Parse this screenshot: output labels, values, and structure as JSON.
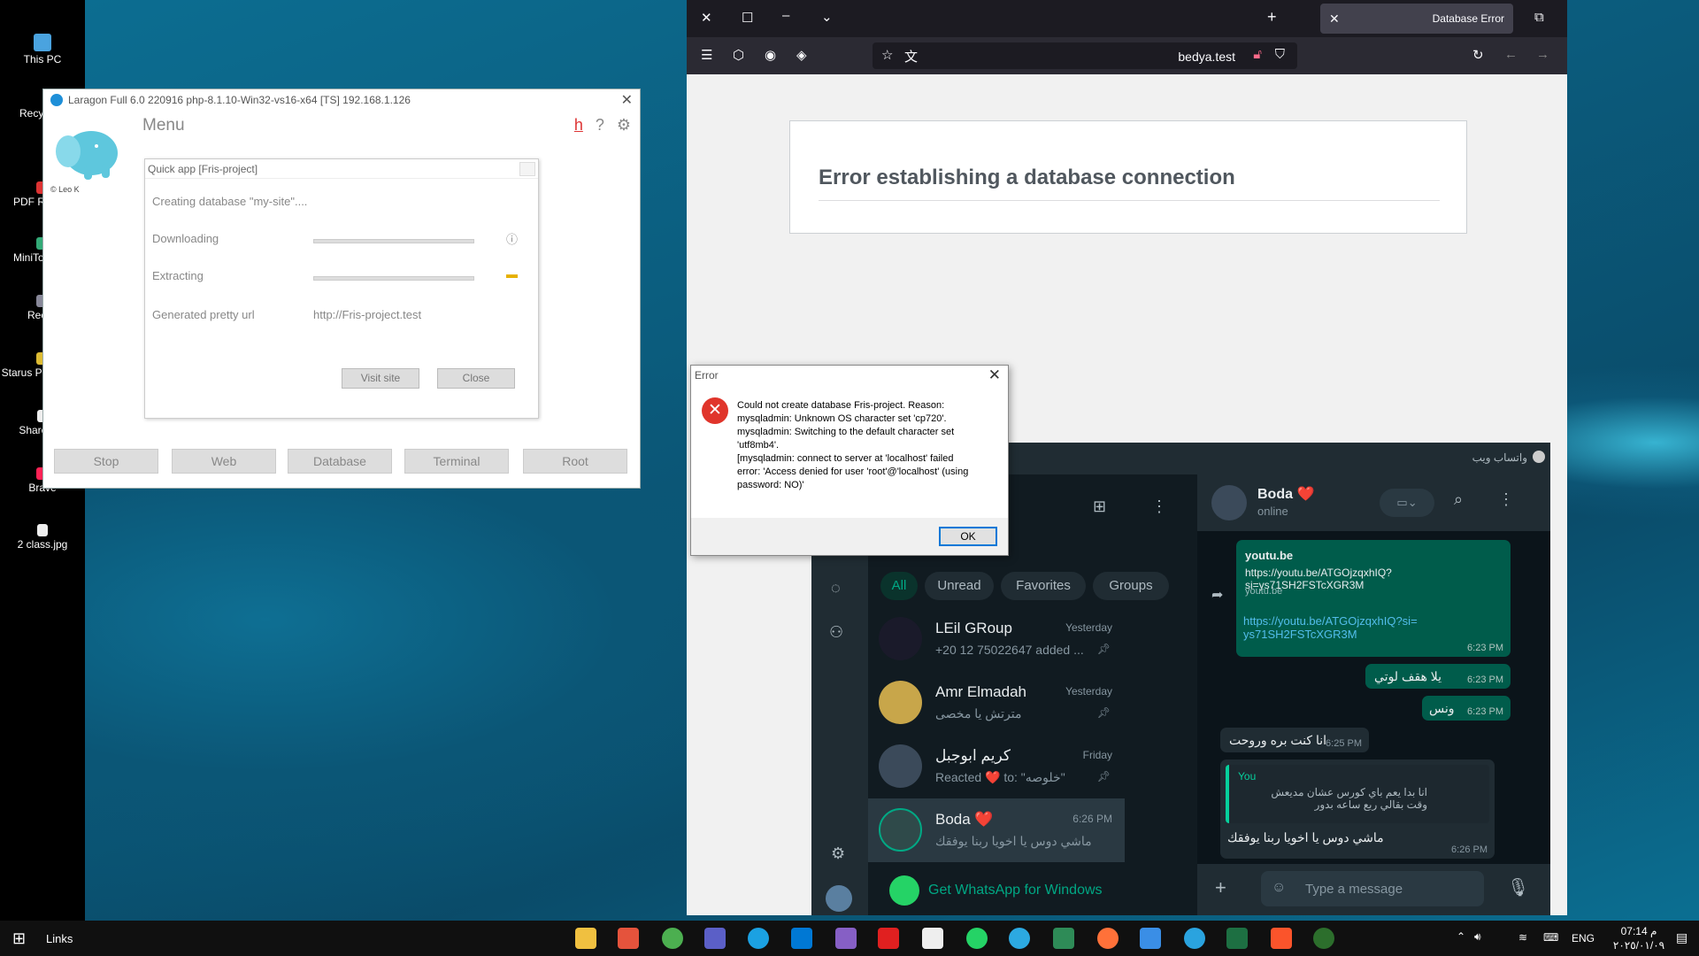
{
  "desktop": {
    "icons": [
      "This PC",
      "Recyc",
      "PDF Rea 10",
      "MiniTo Partit",
      "Recuv",
      "Starus Pl Recove",
      "SharedSe",
      "Brave",
      "2 class.jpg"
    ]
  },
  "laragon": {
    "title": "Laragon Full 6.0 220916 php-8.1.10-Win32-vs16-x64 [TS]  192.168.1.126",
    "copyright": "© Leo K",
    "menu": "Menu",
    "help_h": "h",
    "help_q": "?",
    "buttons": [
      "Stop",
      "Web",
      "Database",
      "Terminal",
      "Root"
    ],
    "quick_app": {
      "title": "Quick app [Fris-project]",
      "status": "Creating database \"my-site\"....",
      "downloading": "Downloading",
      "extracting": "Extracting",
      "pretty_url_label": "Generated pretty url",
      "pretty_url": "http://Fris-project.test",
      "visit_site": "Visit site",
      "close": "Close"
    }
  },
  "browser": {
    "tab_title": "Database Error",
    "url": "bedya.test",
    "heading": "Error establishing a database connection"
  },
  "error_dialog": {
    "title": "Error",
    "message": "Could not create database Fris-project. Reason:\nmysqladmin: Unknown OS character set 'cp720'.\nmysqladmin: Switching to the default character set\n'utf8mb4'.\n[mysqladmin: connect to server at 'localhost' failed\nerror: 'Access denied for user 'root'@'localhost' (using\npassword: NO)'",
    "ok": "OK"
  },
  "whatsapp": {
    "title": "واتساب ويب",
    "filters": [
      "All",
      "Unread",
      "Favorites",
      "Groups"
    ],
    "chats": [
      {
        "name": "LEil GRoup",
        "preview": "+20 12 75022647 added ...",
        "time": "Yesterday"
      },
      {
        "name": "Amr Elmadah",
        "preview": "مترتش يا مخصى",
        "time": "Yesterday"
      },
      {
        "name": "كريم ابوجبل",
        "preview": "Reacted ❤️ to: \"خلوصه\"",
        "time": "Friday"
      },
      {
        "name": "Boda ❤️",
        "preview": "ماشي دوس يا اخويا ربنا يوفقك",
        "time": "6:26 PM"
      }
    ],
    "get_app": "Get WhatsApp for Windows",
    "contact": {
      "name": "Boda ❤️",
      "status": "online"
    },
    "messages": [
      {
        "site": "youtu.be",
        "link": "https://youtu.be/ATGOjzqxhIQ?si=ys71SH2FSTcXGR3M",
        "domain": "youtu.be",
        "time": ""
      },
      {
        "text": "https://youtu.be/ATGOjzqxhIQ?si=ys71SH2FSTcXGR3M",
        "time": "6:23 PM"
      },
      {
        "text": "يلا هقف لوتي",
        "time": "6:23 PM"
      },
      {
        "text": "ونس",
        "time": "6:23 PM"
      },
      {
        "text": "انا كنت بره وروحت",
        "time": "6:25 PM"
      },
      {
        "quote_author": "You",
        "quote_text": "انا بدا يعم باي كورس عشان مديعش وقت بقالي ربع ساعه بدور",
        "text": "ماشي دوس يا اخويا ربنا يوفقك",
        "time": "6:26 PM"
      }
    ],
    "input_placeholder": "Type a message"
  },
  "taskbar": {
    "links": "Links",
    "lang": "ENG",
    "time": "07:14 م",
    "date": "٢٠٢٥/٠١/٠٩"
  },
  "colors": {
    "whatsapp_green": "#00a884",
    "error_red": "#e0352b",
    "laragon_blue": "#1e8fd8"
  }
}
